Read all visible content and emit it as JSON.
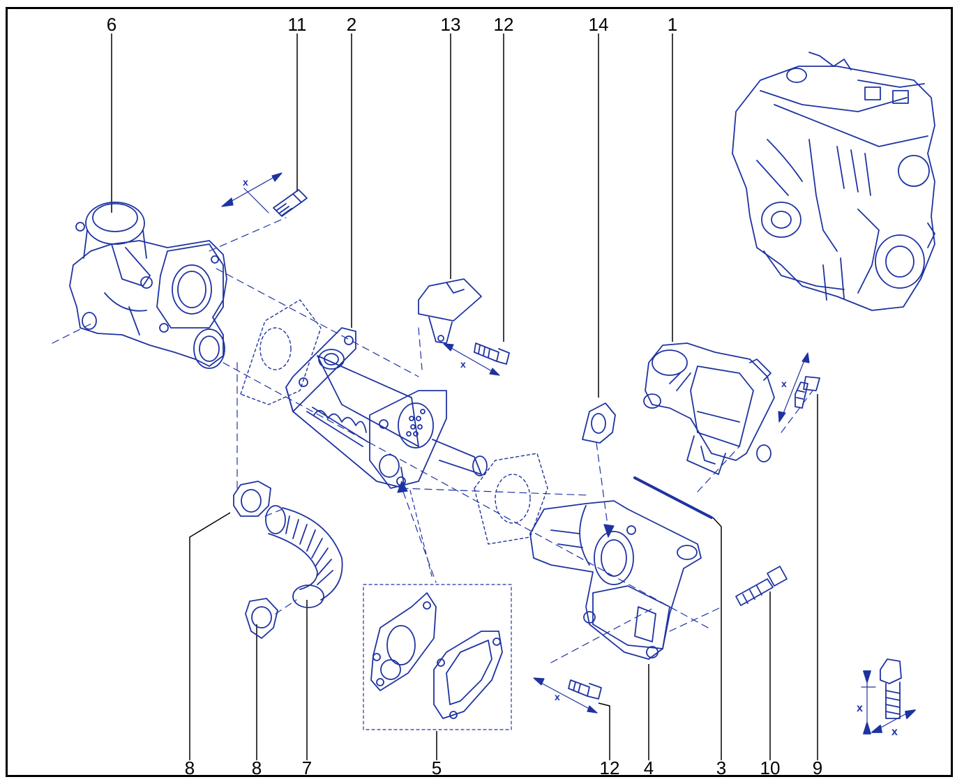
{
  "colors": {
    "drawing": "#1e33a0",
    "leader": "#000000",
    "frame": "#000000"
  },
  "callouts": {
    "top": [
      "6",
      "11",
      "2",
      "13",
      "12",
      "14",
      "1"
    ],
    "bottom": [
      "8",
      "8",
      "7",
      "5",
      "12",
      "4",
      "3",
      "10",
      "9"
    ]
  },
  "dimension_marks": {
    "x": "x"
  }
}
